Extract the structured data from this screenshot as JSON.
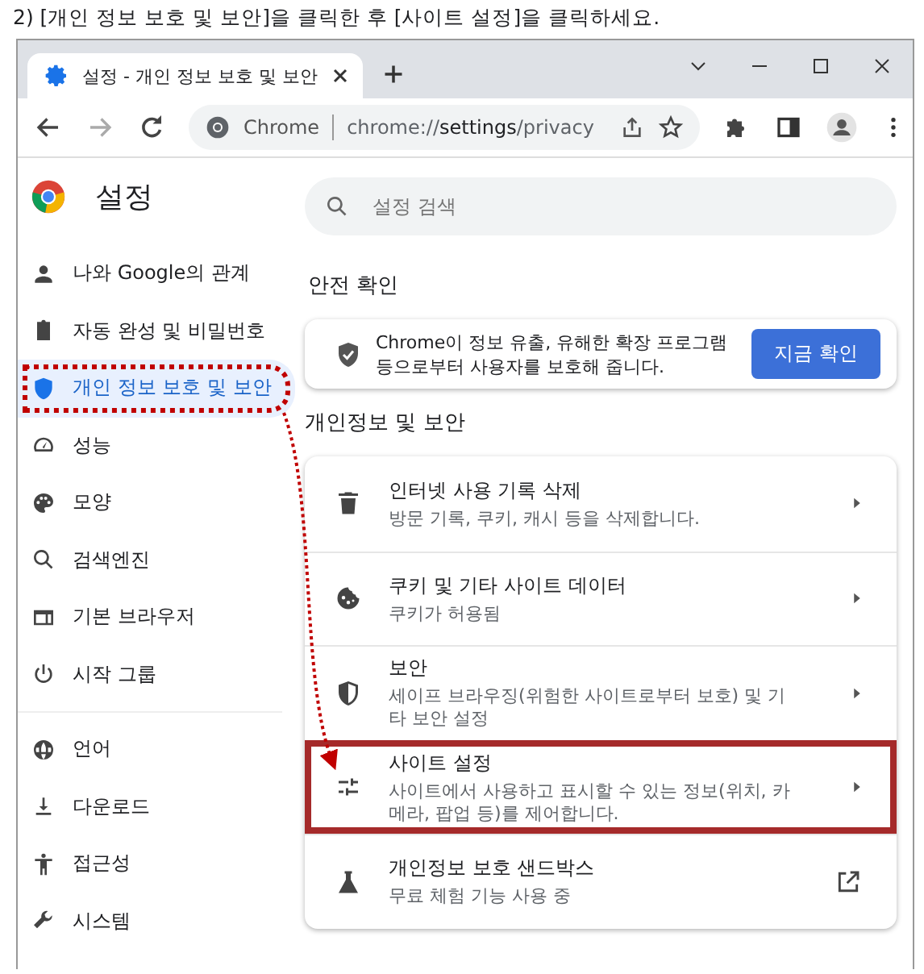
{
  "instruction": "2) [개인 정보 보호 및 보안]을 클릭한 후 [사이트 설정]을 클릭하세요.",
  "tab": {
    "title": "설정 - 개인 정보 보호 및 보안",
    "selected": true
  },
  "address_bar": {
    "site_label": "Chrome",
    "url_host": "chrome://",
    "url_path": "settings",
    "url_rest": "/privacy"
  },
  "sidebar": {
    "title": "설정",
    "sections": [
      [
        {
          "label": "나와 Google의 관계",
          "selected": false,
          "marked": false
        },
        {
          "label": "자동 완성 및 비밀번호",
          "selected": false,
          "marked": false
        },
        {
          "label": "개인 정보 보호 및 보안",
          "selected": true,
          "marked": true
        },
        {
          "label": "성능",
          "selected": false,
          "marked": false
        },
        {
          "label": "모양",
          "selected": false,
          "marked": false
        },
        {
          "label": "검색엔진",
          "selected": false,
          "marked": false
        },
        {
          "label": "기본 브라우저",
          "selected": false,
          "marked": false
        },
        {
          "label": "시작 그룹",
          "selected": false,
          "marked": false
        }
      ],
      [
        {
          "label": "언어",
          "selected": false,
          "marked": false
        },
        {
          "label": "다운로드",
          "selected": false,
          "marked": false
        },
        {
          "label": "접근성",
          "selected": false,
          "marked": false
        },
        {
          "label": "시스템",
          "selected": false,
          "marked": false
        }
      ]
    ]
  },
  "search": {
    "placeholder": "설정 검색"
  },
  "safety_check": {
    "heading": "안전 확인",
    "text": "Chrome이 정보 유출, 유해한 확장 프로그램 등으로부터 사용자를 보호해 줍니다.",
    "button": "지금 확인"
  },
  "privacy": {
    "heading": "개인정보 및 보안",
    "rows": [
      {
        "title": "인터넷 사용 기록 삭제",
        "subtitle": "방문 기록, 쿠키, 캐시 등을 삭제합니다.",
        "kind": "submenu",
        "marked": false
      },
      {
        "title": "쿠키 및 기타 사이트 데이터",
        "subtitle": "쿠키가 허용됨",
        "kind": "submenu",
        "marked": false
      },
      {
        "title": "보안",
        "subtitle": "세이프 브라우징(위험한 사이트로부터 보호) 및 기타 보안 설정",
        "kind": "submenu",
        "marked": false
      },
      {
        "title": "사이트 설정",
        "subtitle": "사이트에서 사용하고 표시할 수 있는 정보(위치, 카메라, 팝업 등)를 제어합니다.",
        "kind": "submenu",
        "marked": true
      },
      {
        "title": "개인정보 보호 샌드박스",
        "subtitle": "무료 체험 기능 사용 중",
        "kind": "external",
        "marked": false
      }
    ]
  }
}
